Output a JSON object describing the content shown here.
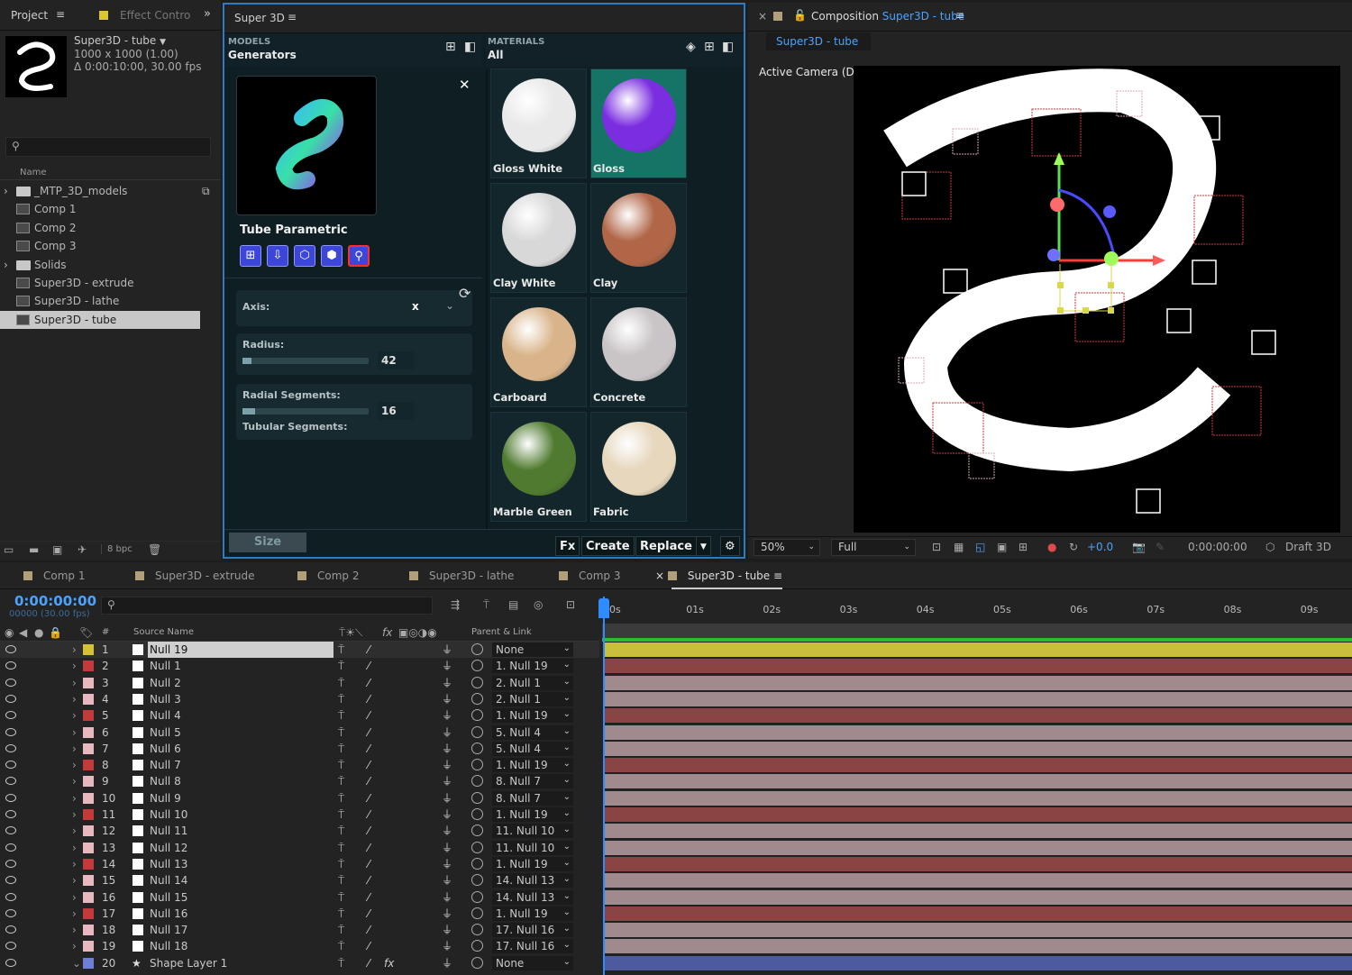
{
  "project_panel": {
    "tab_project": "Project",
    "tab_effect": "Effect Contro",
    "comp_name": "Super3D - tube",
    "comp_size": "1000 x 1000 (1.00)",
    "comp_duration": "Δ 0:00:10:00, 30.00 fps",
    "col_name": "Name",
    "items": [
      {
        "label": "_MTP_3D_models",
        "type": "folder"
      },
      {
        "label": "Comp 1",
        "type": "comp"
      },
      {
        "label": "Comp 2",
        "type": "comp"
      },
      {
        "label": "Comp 3",
        "type": "comp"
      },
      {
        "label": "Solids",
        "type": "folder"
      },
      {
        "label": "Super3D - extrude",
        "type": "comp"
      },
      {
        "label": "Super3D - lathe",
        "type": "comp"
      },
      {
        "label": "Super3D - tube",
        "type": "comp",
        "selected": true
      }
    ],
    "bpc": "8 bpc"
  },
  "super3d": {
    "tab_title": "Super 3D",
    "models_cat": "MODELS",
    "models_sub": "Generators",
    "materials_cat": "MATERIALS",
    "materials_sub": "All",
    "model_name": "Tube Parametric",
    "axis_label": "Axis:",
    "axis_value": "x",
    "radius_label": "Radius:",
    "radius_value": "42",
    "radius_fraction": 0.07,
    "radial_label": "Radial Segments:",
    "radial_value": "16",
    "radial_fraction": 0.1,
    "tubular_label": "Tubular Segments:",
    "materials": [
      {
        "label": "Gloss White",
        "color": "#e9e9e9"
      },
      {
        "label": "Gloss",
        "color": "#7a2ee0",
        "selected": true
      },
      {
        "label": "Clay White",
        "color": "#d8d8d8"
      },
      {
        "label": "Clay",
        "color": "#b06647"
      },
      {
        "label": "Carboard",
        "color": "#d9b48a"
      },
      {
        "label": "Concrete",
        "color": "#c9c4c6"
      },
      {
        "label": "Marble Green",
        "color": "#4f7a2f"
      },
      {
        "label": "Fabric",
        "color": "#e6d7bd"
      }
    ],
    "size_btn": "Size",
    "fx_btn": "Fx",
    "create_btn": "Create",
    "replace_btn": "Replace"
  },
  "composition": {
    "tab_prefix": "Composition",
    "tab_name": "Super3D - tube",
    "sub_tab": "Super3D - tube",
    "camera_label": "Active Camera (Default)",
    "zoom": "50%",
    "resolution": "Full",
    "exposure": "+0.0",
    "timecode": "0:00:00:00",
    "renderer": "Draft 3D"
  },
  "timeline": {
    "tabs": [
      "Comp 1",
      "Super3D - extrude",
      "Comp 2",
      "Super3D - lathe",
      "Comp 3",
      "Super3D - tube"
    ],
    "active_tab": "Super3D - tube",
    "time": "0:00:00:00",
    "frames": "00000 (30.00 fps)",
    "col_source": "Source Name",
    "col_parent": "Parent & Link",
    "col_hash": "#",
    "ruler": [
      "0s",
      "01s",
      "02s",
      "03s",
      "04s",
      "05s",
      "06s",
      "07s",
      "08s",
      "09s"
    ],
    "layers": [
      {
        "num": "1",
        "name": "Null 19",
        "parent": "None",
        "label": "#d4c235",
        "bar": "#c9bf3d"
      },
      {
        "num": "2",
        "name": "Null 1",
        "parent": "1. Null 19",
        "label": "#c23a3a",
        "bar": "#8b4444"
      },
      {
        "num": "3",
        "name": "Null 2",
        "parent": "2. Null 1",
        "label": "#e8b8c0",
        "bar": "#a08a8e"
      },
      {
        "num": "4",
        "name": "Null 3",
        "parent": "2. Null 1",
        "label": "#e8b8c0",
        "bar": "#a08a8e"
      },
      {
        "num": "5",
        "name": "Null 4",
        "parent": "1. Null 19",
        "label": "#c23a3a",
        "bar": "#8b4444"
      },
      {
        "num": "6",
        "name": "Null 5",
        "parent": "5. Null 4",
        "label": "#e8b8c0",
        "bar": "#a08a8e"
      },
      {
        "num": "7",
        "name": "Null 6",
        "parent": "5. Null 4",
        "label": "#e8b8c0",
        "bar": "#a08a8e"
      },
      {
        "num": "8",
        "name": "Null 7",
        "parent": "1. Null 19",
        "label": "#c23a3a",
        "bar": "#8b4444"
      },
      {
        "num": "9",
        "name": "Null 8",
        "parent": "8. Null 7",
        "label": "#e8b8c0",
        "bar": "#a08a8e"
      },
      {
        "num": "10",
        "name": "Null 9",
        "parent": "8. Null 7",
        "label": "#e8b8c0",
        "bar": "#a08a8e"
      },
      {
        "num": "11",
        "name": "Null 10",
        "parent": "1. Null 19",
        "label": "#c23a3a",
        "bar": "#8b4444"
      },
      {
        "num": "12",
        "name": "Null 11",
        "parent": "11. Null 10",
        "label": "#e8b8c0",
        "bar": "#a08a8e"
      },
      {
        "num": "13",
        "name": "Null 12",
        "parent": "11. Null 10",
        "label": "#e8b8c0",
        "bar": "#a08a8e"
      },
      {
        "num": "14",
        "name": "Null 13",
        "parent": "1. Null 19",
        "label": "#c23a3a",
        "bar": "#8b4444"
      },
      {
        "num": "15",
        "name": "Null 14",
        "parent": "14. Null 13",
        "label": "#e8b8c0",
        "bar": "#a08a8e"
      },
      {
        "num": "16",
        "name": "Null 15",
        "parent": "14. Null 13",
        "label": "#e8b8c0",
        "bar": "#a08a8e"
      },
      {
        "num": "17",
        "name": "Null 16",
        "parent": "1. Null 19",
        "label": "#c23a3a",
        "bar": "#8b4444"
      },
      {
        "num": "18",
        "name": "Null 17",
        "parent": "17. Null 16",
        "label": "#e8b8c0",
        "bar": "#a08a8e"
      },
      {
        "num": "19",
        "name": "Null 18",
        "parent": "17. Null 16",
        "label": "#e8b8c0",
        "bar": "#a08a8e"
      },
      {
        "num": "20",
        "name": "Shape Layer 1",
        "parent": "None",
        "label": "#6f7fd8",
        "bar": "#4d5a9e"
      }
    ]
  },
  "colors": {
    "accent": "#2e7bbf",
    "selected_material": "#167466",
    "button_blue": "#3c46d8"
  }
}
